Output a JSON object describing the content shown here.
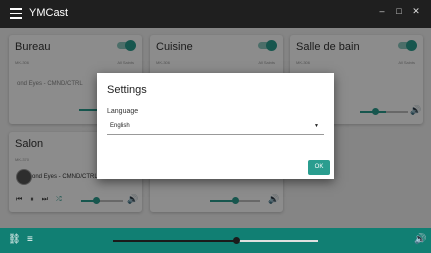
{
  "app": {
    "title": "YMCast"
  },
  "window": {
    "minimize": "–",
    "maximize": "□",
    "close": "✕"
  },
  "rooms": [
    {
      "name": "Bureau",
      "sub": "MK-306",
      "right": "All Saints",
      "now_playing": "ond Eyes - CMND/CTRL",
      "volume": 0.6,
      "enabled": true
    },
    {
      "name": "Cuisine",
      "sub": "MK-306",
      "right": "All Saints",
      "volume": 0.6,
      "enabled": true
    },
    {
      "name": "Salle de bain",
      "sub": "MK-306",
      "right": "All Saints",
      "volume": 0.55,
      "enabled": true
    },
    {
      "name": "Salon",
      "sub": "MK-370",
      "now_playing": "ond Eyes - CMND/CTRL",
      "volume": 0.45,
      "enabled": true
    }
  ],
  "player_controls": {
    "prev": "⏮",
    "pause": "⏸",
    "next": "⏭",
    "shuffle": "⤮"
  },
  "settings_dialog": {
    "title": "Settings",
    "language_label": "Language",
    "language_value": "English",
    "dropdown_arrow": "▼",
    "ok_label": "OK"
  },
  "bottom_bar": {
    "link_icon": "⛓",
    "queue_icon": "≡",
    "volume_icon": "🔊",
    "seek": 0.6
  },
  "colors": {
    "accent": "#2a9d8f",
    "bottom_bar": "#117f73",
    "titlebar": "#1f1f1f"
  }
}
